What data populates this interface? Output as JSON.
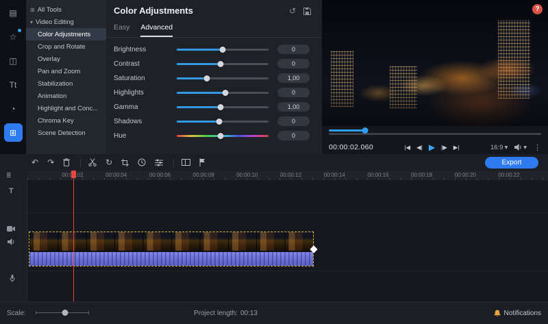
{
  "icon_rail": {
    "items": [
      {
        "name": "import",
        "glyph": "▤"
      },
      {
        "name": "filters",
        "glyph": "☆"
      },
      {
        "name": "transitions",
        "glyph": "◫"
      },
      {
        "name": "titles",
        "glyph": "Tt"
      },
      {
        "name": "stickers",
        "glyph": "◔"
      },
      {
        "name": "more-tools",
        "glyph": "⊞"
      }
    ]
  },
  "menu": {
    "items": [
      {
        "label": "All Tools",
        "glyph": "⊞"
      },
      {
        "label": "Video Editing",
        "glyph": "▾"
      },
      {
        "label": "Color Adjustments"
      },
      {
        "label": "Crop and Rotate"
      },
      {
        "label": "Overlay"
      },
      {
        "label": "Pan and Zoom"
      },
      {
        "label": "Stabilization"
      },
      {
        "label": "Animation"
      },
      {
        "label": "Highlight and Conc..."
      },
      {
        "label": "Chroma Key"
      },
      {
        "label": "Scene Detection"
      }
    ]
  },
  "adjustments": {
    "title": "Color Adjustments",
    "reset_glyph": "↺",
    "tabs": {
      "easy": "Easy",
      "advanced": "Advanced"
    },
    "sliders": [
      {
        "label": "Brightness",
        "value": "0",
        "percent": 50
      },
      {
        "label": "Contrast",
        "value": "0",
        "percent": 48
      },
      {
        "label": "Saturation",
        "value": "1,00",
        "percent": 33
      },
      {
        "label": "Highlights",
        "value": "0",
        "percent": 53
      },
      {
        "label": "Gamma",
        "value": "1,00",
        "percent": 48
      },
      {
        "label": "Shadows",
        "value": "0",
        "percent": 46
      },
      {
        "label": "Hue",
        "value": "0",
        "percent": 48,
        "rainbow": true
      }
    ]
  },
  "preview": {
    "help_label": "?",
    "timecode": "00:00:02.060",
    "progress_percent": 17,
    "transport": {
      "prev": "|◀",
      "step_back": "◀|",
      "play": "▶",
      "step_fwd": "|▶",
      "next": "▶|"
    },
    "aspect_ratio": "16:9",
    "caret": "▾",
    "kebab": "⋮"
  },
  "toolbar": {
    "export_label": "Export",
    "icons": {
      "undo": "↶",
      "redo": "↷",
      "rotate": "↻"
    }
  },
  "timeline": {
    "manage_glyph": "≣",
    "title_track_glyph": "T",
    "ruler_labels": [
      "00:00:02",
      "00:00:04",
      "00:00:06",
      "00:00:08",
      "00:00:10",
      "00:00:12",
      "00:00:14",
      "00:00:16",
      "00:00:18",
      "00:00:20",
      "00:00:22"
    ]
  },
  "statusbar": {
    "scale_label": "Scale:",
    "project_length_label": "Project length:",
    "project_length_value": "00:13",
    "notifications_label": "Notifications"
  },
  "colors": {
    "accent": "#2e7bf0",
    "selection": "#e3bd3a",
    "playhead": "#e8473f"
  }
}
